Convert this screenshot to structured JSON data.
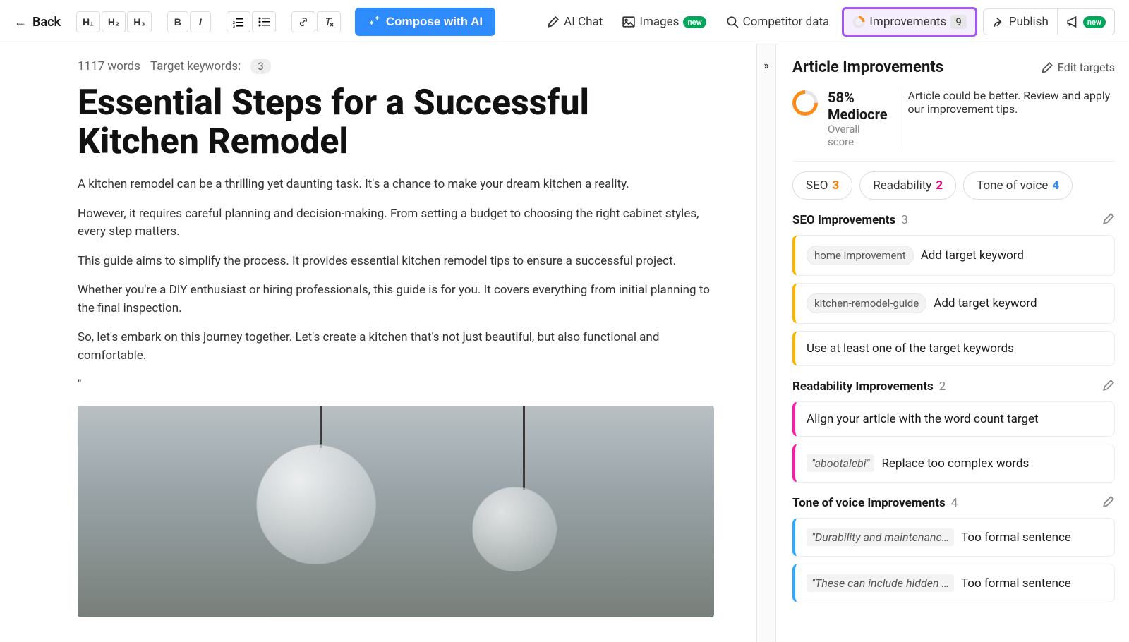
{
  "topbar": {
    "back_label": "Back",
    "headings": [
      "H₁",
      "H₂",
      "H₃"
    ],
    "compose_label": "Compose with AI",
    "ai_chat_label": "AI Chat",
    "images_label": "Images",
    "images_badge": "new",
    "competitor_label": "Competitor data",
    "improvements_label": "Improvements",
    "improvements_count": "9",
    "publish_label": "Publish",
    "publish_badge": "new"
  },
  "editor": {
    "word_count": "1117 words",
    "target_keywords_label": "Target keywords:",
    "target_keywords_count": "3",
    "title": "Essential Steps for a Successful Kitchen Remodel",
    "paragraphs": [
      "A kitchen remodel can be a thrilling yet daunting task. It's a chance to make your dream kitchen a reality.",
      "However, it requires careful planning and decision-making. From setting a budget to choosing the right cabinet styles, every step matters.",
      "This guide aims to simplify the process. It provides essential kitchen remodel tips to ensure a successful project.",
      "Whether you're a DIY enthusiast or hiring professionals, this guide is for you. It covers everything from initial planning to the final inspection.",
      "So, let's embark on this journey together. Let's create a kitchen that's not just beautiful, but also functional and comfortable.",
      "\""
    ]
  },
  "panel": {
    "title": "Article Improvements",
    "edit_targets_label": "Edit targets",
    "score": {
      "value": "58% Mediocre",
      "sub": "Overall score",
      "description": "Article could be better. Review and apply our improvement tips."
    },
    "tabs": {
      "seo_label": "SEO",
      "seo_count": "3",
      "read_label": "Readability",
      "read_count": "2",
      "tone_label": "Tone of voice",
      "tone_count": "4"
    },
    "sections": {
      "seo": {
        "title": "SEO Improvements",
        "count": "3",
        "tips": [
          {
            "chip": "home improvement",
            "text": "Add target keyword"
          },
          {
            "chip": "kitchen-remodel-guide",
            "text": "Add target keyword"
          },
          {
            "text": "Use at least one of the target keywords"
          }
        ]
      },
      "readability": {
        "title": "Readability Improvements",
        "count": "2",
        "tips": [
          {
            "text": "Align your article with the word count target"
          },
          {
            "quote": "\"abootalebi\"",
            "text": "Replace too complex words"
          }
        ]
      },
      "tone": {
        "title": "Tone of voice Improvements",
        "count": "4",
        "tips": [
          {
            "quote": "\"Durability and maintenanc…",
            "text": "Too formal sentence"
          },
          {
            "quote": "\"These can include hidden …",
            "text": "Too formal sentence"
          }
        ]
      }
    }
  }
}
